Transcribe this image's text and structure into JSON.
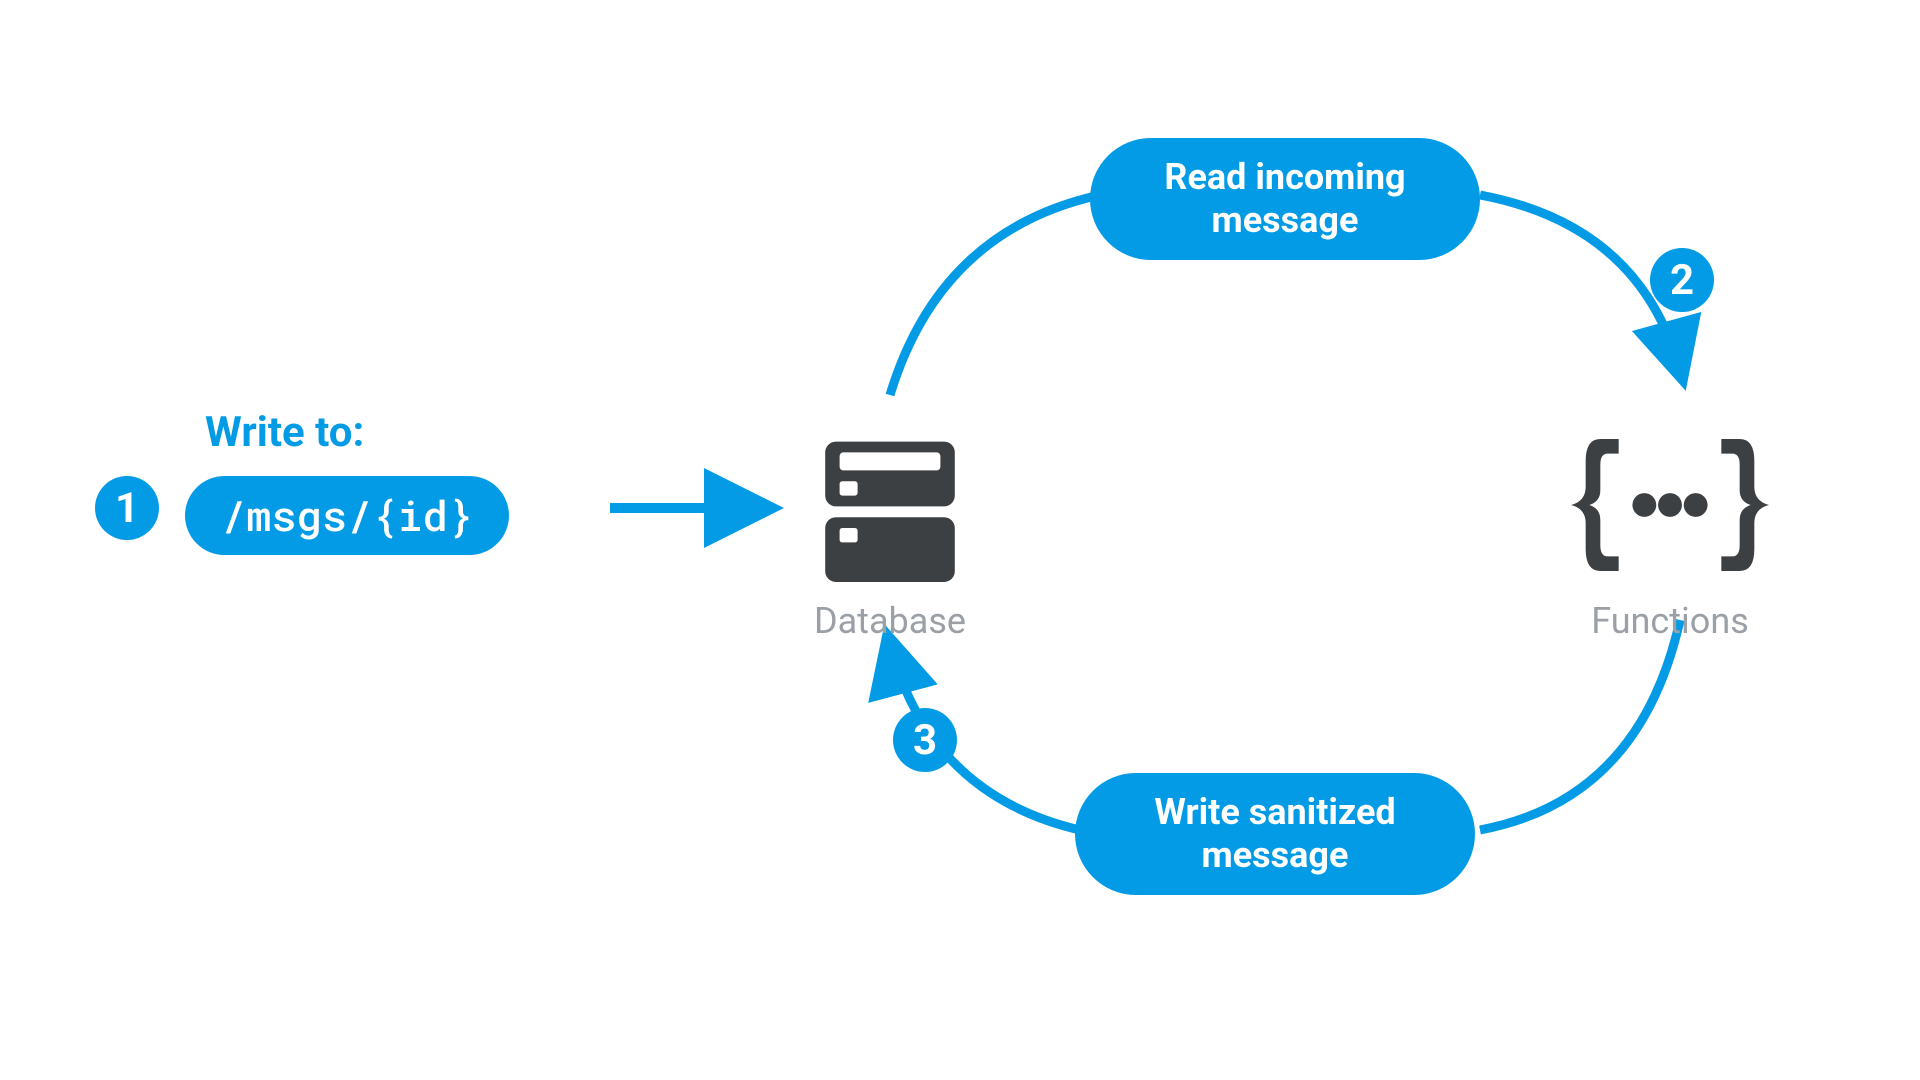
{
  "colors": {
    "accent": "#039be5",
    "icon": "#3c4043",
    "muted": "#9aa0a6"
  },
  "writeLabel": "Write to:",
  "writePath": "/msgs/{id}",
  "steps": {
    "one": "1",
    "two": "2",
    "three": "3"
  },
  "pills": {
    "top": {
      "line1": "Read incoming",
      "line2": "message"
    },
    "bottom": {
      "line1": "Write sanitized",
      "line2": "message"
    }
  },
  "nodes": {
    "database": "Database",
    "functions": "Functions"
  }
}
